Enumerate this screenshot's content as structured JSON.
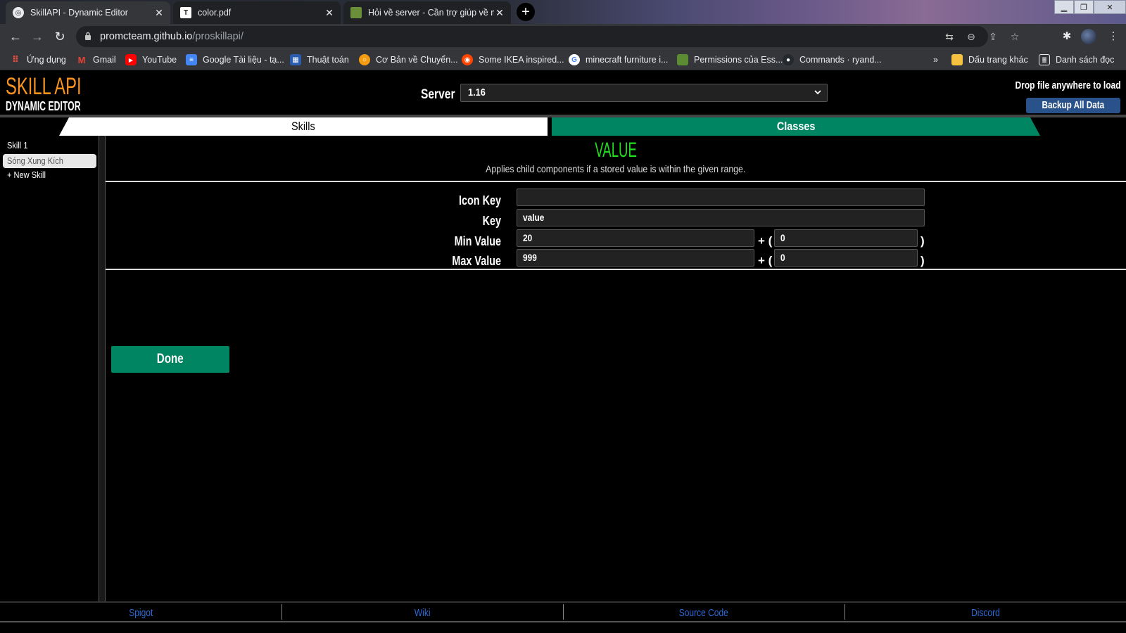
{
  "browser": {
    "tabs": [
      {
        "title": "SkillAPI - Dynamic Editor",
        "active": true
      },
      {
        "title": "color.pdf",
        "active": false
      },
      {
        "title": "Hỏi về server - Cần trợ giúp về m",
        "active": false
      }
    ],
    "url_host": "promcteam.github.io",
    "url_path": "/proskillapi/",
    "bookmarks": [
      "Ứng dụng",
      "Gmail",
      "YouTube",
      "Google Tài liệu - tạ...",
      "Thuật toán",
      "Cơ Bản về Chuyển...",
      "Some IKEA inspired...",
      "minecraft furniture i...",
      "Permissions của Ess...",
      "Commands · ryand..."
    ],
    "bookmarks_more": "»",
    "other_bookmarks": "Dấu trang khác",
    "reading_list": "Danh sách đọc"
  },
  "app": {
    "logo_title": "SKILL API",
    "logo_subtitle": "DYNAMIC EDITOR",
    "server_label": "Server",
    "server_value": "1.16",
    "drop_hint": "Drop file anywhere to load",
    "backup_label": "Backup All Data",
    "tab_skills": "Skills",
    "tab_classes": "Classes",
    "skill_list": [
      "Skill 1",
      "Sóng Xung Kích",
      "+ New Skill"
    ],
    "component": {
      "title": "VALUE",
      "description": "Applies child components if a stored value is within the given range.",
      "fields": {
        "icon_key_label": "Icon Key",
        "icon_key_value": "",
        "key_label": "Key",
        "key_value": "value",
        "min_label": "Min Value",
        "min_value": "20",
        "min_scale": "0",
        "max_label": "Max Value",
        "max_value": "999",
        "max_scale": "0",
        "plus_paren": "+ (",
        "close_paren": ")"
      }
    },
    "done_label": "Done",
    "footer_links": [
      "Spigot",
      "Wiki",
      "Source Code",
      "Discord"
    ]
  },
  "colors": {
    "accent_green": "#008563",
    "title_green": "#1fdd1f",
    "logo_orange": "#f7931e",
    "link_blue": "#2e6bd6",
    "backup_blue": "#29528a"
  }
}
